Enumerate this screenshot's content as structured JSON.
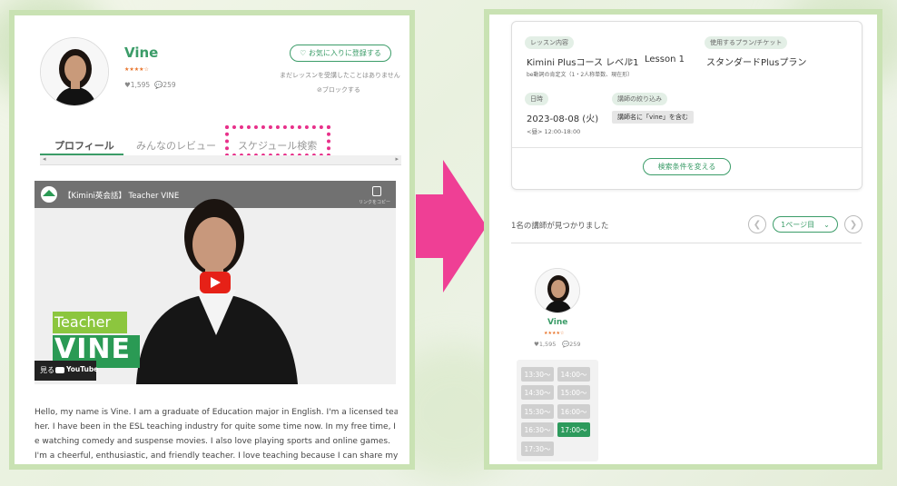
{
  "left_panel": {
    "teacher_name": "Vine",
    "rating_stars": "★★★★☆",
    "likes": "♥1,595",
    "reviews": "💬259",
    "favorite_button": "♡ お気に入りに登録する",
    "no_lesson_text": "まだレッスンを受講したことはありません",
    "block_text": "⊘ブロックする",
    "tabs": [
      "プロフィール",
      "みんなのレビュー",
      "スケジュール検索"
    ],
    "video_title": "【Kimini英会話】 Teacher VINE",
    "video_copy_label": "リンクをコピー",
    "video_overlay_line1": "Teacher",
    "video_overlay_line2": "VINE",
    "watch_on": "見る",
    "youtube_label": "YouTube",
    "bio_lines": [
      "Hello, my name is Vine. I am a graduate of Education major in English. I'm a licensed teac",
      "her. I have been in the ESL teaching industry for quite some time now. In my free time, I lik",
      "e watching comedy and suspense movies. I also love playing sports and online games.",
      "I'm a cheerful, enthusiastic, and friendly teacher. I love teaching because I can share my k"
    ]
  },
  "right_panel": {
    "lesson_tag": "レッスン内容",
    "lesson_course": "Kimini Plusコース レベル1",
    "lesson_unit": "Lesson 1",
    "lesson_sub": "be動詞の肯定文（1・2人称単数、現在形）",
    "plan_tag": "使用するプラン/チケット",
    "plan_name": "スタンダードPlusプラン",
    "date_tag": "日時",
    "date_value": "2023-08-08 (火)",
    "time_value": "<昼> 12:00-18:00",
    "filter_tag": "講師の絞り込み",
    "filter_value": "講師名に「vine」を含む",
    "change_button": "検索条件を変える",
    "result_count": "1名の講師が見つかりました",
    "page_select": "1ページ目",
    "teacher_name": "Vine",
    "rating_stars": "★★★★☆",
    "likes": "♥1,595",
    "reviews": "💬259",
    "slots": [
      "13:30〜",
      "14:00〜",
      "14:30〜",
      "15:00〜",
      "15:30〜",
      "16:00〜",
      "16:30〜",
      "17:00〜",
      "17:30〜"
    ],
    "active_slot": "17:00〜"
  },
  "colors": {
    "accent_green": "#3b9c68",
    "active_slot": "#2d9a5c",
    "highlight_pink": "#e8308a",
    "arrow_pink": "#ef3f95",
    "panel_border": "#c9e2b3"
  }
}
